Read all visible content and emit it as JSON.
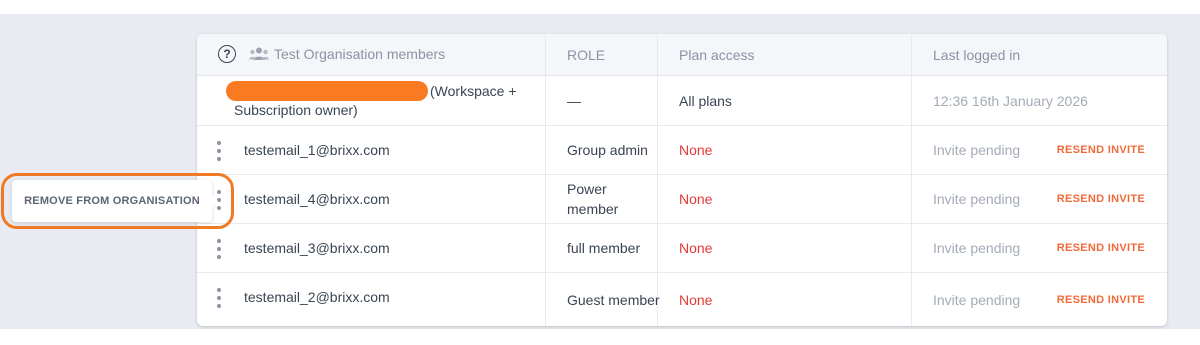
{
  "header": {
    "help_icon_glyph": "?",
    "title": "Test Organisation members",
    "role": "ROLE",
    "plan_access": "Plan access",
    "last_logged_in": "Last logged in"
  },
  "owner": {
    "email_redacted": true,
    "suffix": "(Workspace +",
    "line2": "Subscription owner)",
    "role": "—",
    "plan": "All plans",
    "last_login": "12:36 16th January 2026"
  },
  "members": [
    {
      "email": "testemail_1@brixx.com",
      "role": "Group admin",
      "plan": "None",
      "last_login": "Invite pending",
      "action": "RESEND INVITE"
    },
    {
      "email": "testemail_4@brixx.com",
      "role": "Power member",
      "plan": "None",
      "last_login": "Invite pending",
      "action": "RESEND INVITE"
    },
    {
      "email": "testemail_3@brixx.com",
      "role": "full member",
      "plan": "None",
      "last_login": "Invite pending",
      "action": "RESEND INVITE"
    },
    {
      "email": "testemail_2@brixx.com",
      "role": "Guest member",
      "plan": "None",
      "last_login": "Invite pending",
      "action": "RESEND INVITE"
    }
  ],
  "context_menu": {
    "remove_label": "REMOVE FROM ORGANISATION"
  },
  "colors": {
    "none_red": "#e53935",
    "resend_orange": "#f06a3a",
    "highlight_orange": "#f07a24"
  }
}
